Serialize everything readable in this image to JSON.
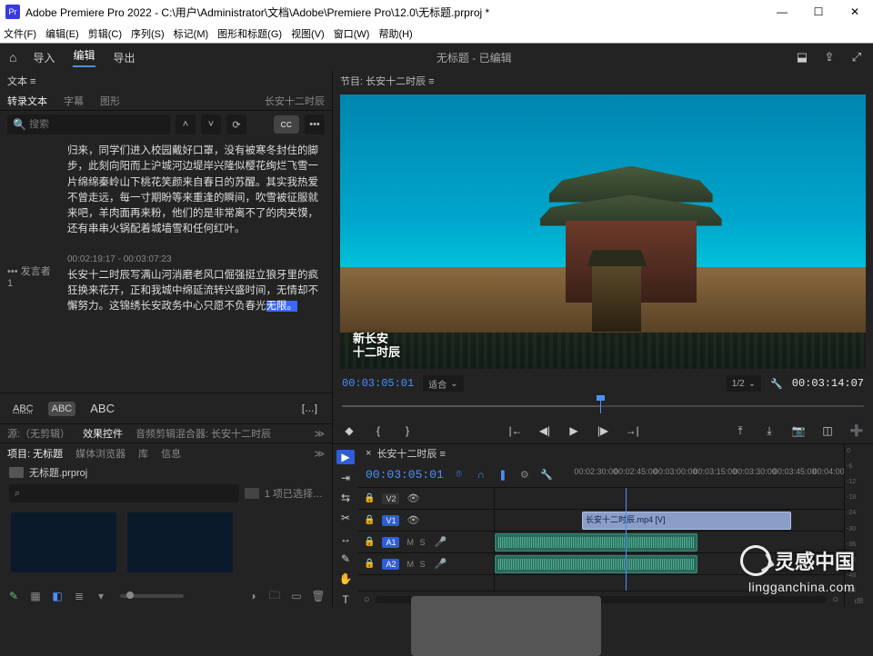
{
  "titlebar": {
    "app_icon_label": "Pr",
    "title": "Adobe Premiere Pro 2022 - C:\\用户\\Administrator\\文档\\Adobe\\Premiere Pro\\12.0\\无标题.prproj *"
  },
  "menubar": [
    "文件(F)",
    "编辑(E)",
    "剪辑(C)",
    "序列(S)",
    "标记(M)",
    "图形和标题(G)",
    "视图(V)",
    "窗口(W)",
    "帮助(H)"
  ],
  "workspace": {
    "home_icon": "home-icon",
    "tabs": [
      {
        "label": "导入",
        "active": false
      },
      {
        "label": "编辑",
        "active": true
      },
      {
        "label": "导出",
        "active": false
      }
    ],
    "center": "无标题 - 已编辑",
    "right_icons": [
      "quick-export-icon",
      "share-icon",
      "fullscreen-icon"
    ]
  },
  "text_panel": {
    "title": "文本 ≡",
    "tabs": [
      {
        "label": "转录文本",
        "active": true
      },
      {
        "label": "字幕",
        "active": false
      },
      {
        "label": "图形",
        "active": false
      }
    ],
    "right_label": "长安十二时辰",
    "search_placeholder": "搜索",
    "cc_label": "CC",
    "segments": [
      {
        "speaker": "",
        "tc": "",
        "body": "归来，同学们进入校园戴好口罩，没有被寒冬封住的脚步，此刻向阳而上沪城河边堤岸兴隆似樱花绚烂飞雪一片绵绵秦岭山下桃花笑颜来自春日的苏醒。其实我热爱不曾走远，每一寸期盼等来重逢的瞬间，吹雪被征服就来吧，羊肉面再来粉，他们的是非常离不了的肉夹馍，还有串串火锅配着城墙雪和任何红叶。"
      },
      {
        "speaker": "••• 发言者 1",
        "tc": "00:02:19:17 - 00:03:07:23",
        "body": "长安十二时辰写满山河消磨老风口倔强挺立狼牙里的疯狂换来花开，正和我城中绵延流转兴盛时间，无情却不懈努力。这锦绣长安政务中心只愿不负春光",
        "tail": "无限。"
      }
    ],
    "footer_labels": [
      "ABC",
      "ABC",
      "ABC"
    ],
    "footer_dots": "[…]"
  },
  "effects_row": {
    "tabs": [
      {
        "label": "源:（无剪辑）",
        "active": false
      },
      {
        "label": "效果控件",
        "active": true
      },
      {
        "label": "音频剪辑混合器: 长安十二时辰",
        "active": false
      }
    ],
    "overflow": "≫"
  },
  "project": {
    "tabs": [
      {
        "label": "项目: 无标题",
        "active": true
      },
      {
        "label": "媒体浏览器"
      },
      {
        "label": "库"
      },
      {
        "label": "信息"
      }
    ],
    "overflow": "≫",
    "bin_name": "无标题.prproj",
    "selected_status": "1 项已选择…",
    "footer_icons": [
      "pen-icon",
      "new-item-icon",
      "list-view-icon",
      "icon-folder",
      "label-icon",
      "zoom-slider",
      "spacer",
      "new-bin-icon",
      "find-icon",
      "trash-icon"
    ]
  },
  "program": {
    "header": "节目: 长安十二时辰 ≡",
    "tc_left": "00:03:05:01",
    "fit_label": "适合",
    "scale_label": "1/2",
    "tc_right": "00:03:14:07",
    "watermark_lines": [
      "新长安",
      "十二时辰"
    ],
    "stamp_text": "灵感中国",
    "stamp_url": "lingganchina.com",
    "transport_icons": [
      "add-marker-icon",
      "mark-in-icon",
      "mark-out-icon",
      "goto-in-icon",
      "step-back-icon",
      "play-icon",
      "step-fwd-icon",
      "goto-out-icon",
      "lift-icon",
      "extract-icon",
      "export-frame-icon",
      "comparison-icon",
      "settings-icon",
      "add-icon"
    ]
  },
  "timeline": {
    "tools": [
      {
        "name": "selection-tool",
        "glyph": "▶",
        "active": true
      },
      {
        "name": "track-select-tool",
        "glyph": "⇥"
      },
      {
        "name": "ripple-tool",
        "glyph": "⇆"
      },
      {
        "name": "razor-tool",
        "glyph": "✂"
      },
      {
        "name": "slip-tool",
        "glyph": "↔"
      },
      {
        "name": "pen-tool",
        "glyph": "✎"
      },
      {
        "name": "hand-tool",
        "glyph": "✋"
      },
      {
        "name": "type-tool",
        "glyph": "T"
      }
    ],
    "tab_label": "长安十二时辰 ≡",
    "tc": "00:03:05:01",
    "toggle_icons": [
      "snap",
      "marker",
      "link",
      "settings",
      "wrench"
    ],
    "ruler_ticks": [
      "00:02:30:00",
      "00:02:45:00",
      "00:03:00:00",
      "00:03:15:00",
      "00:03:30:00",
      "00:03:45:00",
      "00:04:00:00"
    ],
    "tracks": [
      {
        "tag": "V2",
        "sel": false,
        "type": "v"
      },
      {
        "tag": "V1",
        "sel": true,
        "type": "v",
        "clip": {
          "label": "长安十二时辰.mp4 [V]"
        }
      },
      {
        "tag": "A1",
        "sel": true,
        "type": "a",
        "clip": true
      },
      {
        "tag": "A2",
        "sel": true,
        "type": "a",
        "clip": true
      }
    ],
    "meter_marks": [
      "0",
      "-6",
      "-12",
      "-18",
      "-24",
      "-30",
      "-36",
      "-42",
      "-48",
      "-54"
    ],
    "meter_unit": "dB"
  }
}
